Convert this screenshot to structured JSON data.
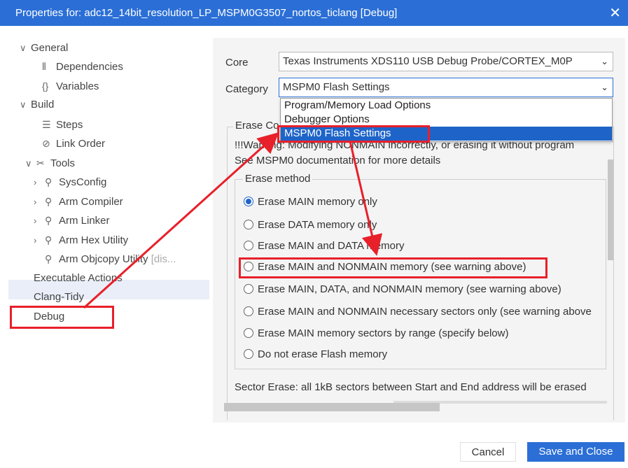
{
  "window": {
    "title": "Properties for: adc12_14bit_resolution_LP_MSPM0G3507_nortos_ticlang [Debug]",
    "close_glyph": "✕"
  },
  "sidebar": {
    "items": [
      {
        "label": "General",
        "twisty": "∨",
        "icon": ""
      },
      {
        "label": "Dependencies",
        "twisty": "",
        "icon": "⫴"
      },
      {
        "label": "Variables",
        "twisty": "",
        "icon": "{}"
      },
      {
        "label": "Build",
        "twisty": "∨",
        "icon": ""
      },
      {
        "label": "Steps",
        "twisty": "",
        "icon": "☰"
      },
      {
        "label": "Link Order",
        "twisty": "",
        "icon": "⊘"
      },
      {
        "label": "Tools",
        "twisty": "∨",
        "icon": "✂"
      },
      {
        "label": "SysConfig",
        "twisty": "›",
        "icon": "⚲"
      },
      {
        "label": "Arm Compiler",
        "twisty": "›",
        "icon": "⚲"
      },
      {
        "label": "Arm Linker",
        "twisty": "›",
        "icon": "⚲"
      },
      {
        "label": "Arm Hex Utility",
        "twisty": "›",
        "icon": "⚲"
      },
      {
        "label": "Arm Objcopy Utility",
        "twisty": "",
        "icon": "⚲",
        "suffix": "[dis..."
      },
      {
        "label": "Executable Actions",
        "twisty": "",
        "icon": ""
      },
      {
        "label": "Clang-Tidy",
        "twisty": "",
        "icon": ""
      },
      {
        "label": "Debug",
        "twisty": "",
        "icon": ""
      }
    ],
    "selected": "Debug"
  },
  "core": {
    "label": "Core",
    "value": "Texas Instruments XDS110 USB Debug Probe/CORTEX_M0P"
  },
  "category": {
    "label": "Category",
    "value": "MSPM0 Flash Settings",
    "options": [
      "Program/Memory Load Options",
      "Debugger Options",
      "MSPM0 Flash Settings"
    ]
  },
  "erase": {
    "group_label": "Erase Co",
    "warning_line1": "!!!Warning: Modifying NONMAIN incorrectly, or erasing it without program",
    "warning_line2": "See MSPM0 documentation for more details",
    "method_label": "Erase method",
    "options": [
      "Erase MAIN memory only",
      "Erase DATA memory only",
      "Erase MAIN and DATA memory",
      "Erase MAIN and NONMAIN memory (see warning above)",
      "Erase MAIN, DATA, and NONMAIN memory (see warning above)",
      "Erase MAIN and NONMAIN necessary sectors only (see warning above",
      "Erase MAIN memory sectors by range (specify below)",
      "Do not erase Flash memory"
    ],
    "selected_index": 0,
    "sector_note": "Sector Erase: all 1kB sectors between Start and End address will be erased"
  },
  "buttons": {
    "cancel": "Cancel",
    "save": "Save and Close"
  },
  "colors": {
    "accent": "#2b6fd6",
    "annotation": "#e8202a"
  }
}
